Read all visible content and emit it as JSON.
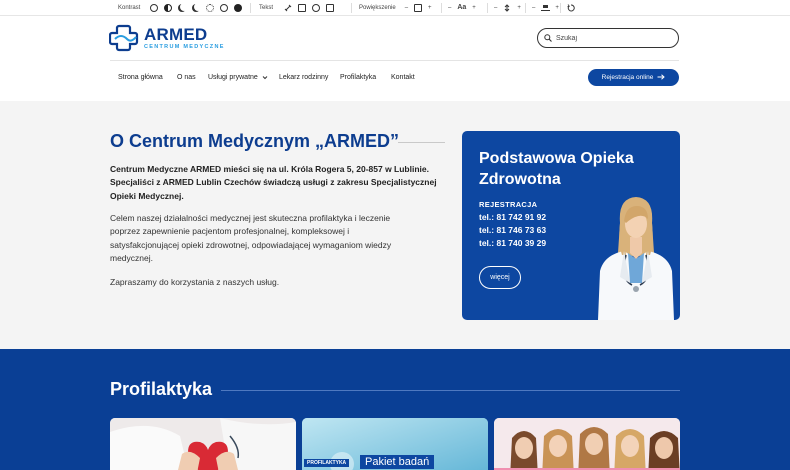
{
  "toolbar": {
    "contrast_label": "Kontrast",
    "text_label": "Tekst",
    "zoom_label": "Powiększenie",
    "font_label": "Aa",
    "minus": "–",
    "plus": "+"
  },
  "header": {
    "logo_title": "ARMED",
    "logo_subtitle": "CENTRUM MEDYCZNE",
    "search_placeholder": "Szukaj",
    "search_value": ""
  },
  "nav": {
    "items": [
      "Strona główna",
      "O nas",
      "Usługi prywatne",
      "Lekarz rodzinny",
      "Profilaktyka",
      "Kontakt"
    ],
    "register_label": "Rejestracja online"
  },
  "hero": {
    "title": "O Centrum Medycznym „ARMED”",
    "lead": "Centrum Medyczne ARMED mieści się na ul. Króla Rogera 5, 20-857 w Lublinie. Specjaliści z ARMED Lublin Czechów świadczą usługi z zakresu Specjalistycznej Opieki Medycznej.",
    "paragraph": "Celem naszej działalności medycznej jest skuteczna profilaktyka i leczenie poprzez zapewnienie pacjentom profesjonalnej, kompleksowej i satysfakcjonującej opieki zdrowotnej, odpowiadającej wymaganiom wiedzy medycznej.",
    "paragraph2": "Zapraszamy do korzystania z naszych usług."
  },
  "card": {
    "title": "Podstawowa Opieka Zdrowotna",
    "registration": "REJESTRACJA",
    "phones": [
      "tel.: 81 742 91 92",
      "tel.: 81 746 73 63",
      "tel.: 81 740 39 29"
    ],
    "button": "więcej"
  },
  "section": {
    "title": "Profilaktyka",
    "tile2_badge": "PROFILAKTYKA",
    "tile2_text": "Pakiet badań"
  },
  "colors": {
    "brand_blue": "#0d47a1",
    "dark_blue": "#0a3f95",
    "title_blue": "#0d3d8f",
    "accent_light_blue": "#2a9de0",
    "hero_bg": "#f4f4f4"
  },
  "icons": [
    "contrast-icon",
    "search-icon",
    "arrow-right-icon",
    "chevron-down-icon",
    "reset-icon"
  ]
}
